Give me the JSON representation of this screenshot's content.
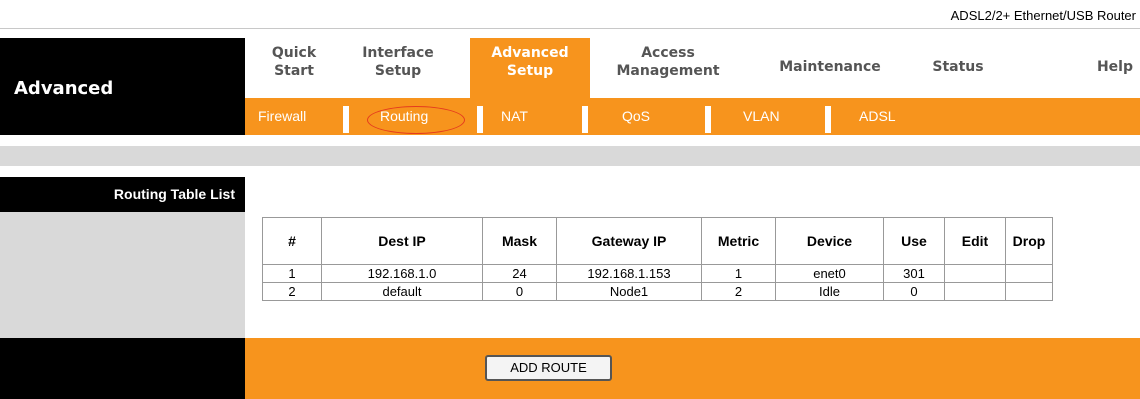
{
  "header": {
    "product_name": "ADSL2/2+ Ethernet/USB Router",
    "brand_label": "Advanced"
  },
  "nav": {
    "items": [
      {
        "label": "Quick\nStart",
        "active": false
      },
      {
        "label": "Interface\nSetup",
        "active": false
      },
      {
        "label": "Advanced\nSetup",
        "active": true
      },
      {
        "label": "Access\nManagement",
        "active": false
      },
      {
        "label": "Maintenance",
        "active": false
      },
      {
        "label": "Status",
        "active": false
      },
      {
        "label": "Help",
        "active": false
      }
    ]
  },
  "subnav": {
    "items": [
      {
        "label": "Firewall"
      },
      {
        "label": "Routing",
        "highlighted": true
      },
      {
        "label": "NAT"
      },
      {
        "label": "QoS"
      },
      {
        "label": "VLAN"
      },
      {
        "label": "ADSL"
      }
    ]
  },
  "section": {
    "title": "Routing Table List"
  },
  "routing_table": {
    "columns": [
      "#",
      "Dest IP",
      "Mask",
      "Gateway IP",
      "Metric",
      "Device",
      "Use",
      "Edit",
      "Drop"
    ],
    "rows": [
      [
        "1",
        "192.168.1.0",
        "24",
        "192.168.1.153",
        "1",
        "enet0",
        "301",
        "",
        ""
      ],
      [
        "2",
        "default",
        "0",
        "Node1",
        "2",
        "Idle",
        "0",
        "",
        ""
      ]
    ]
  },
  "footer": {
    "add_route_label": "ADD ROUTE"
  },
  "colors": {
    "accent": "#f7941d",
    "highlight_ring": "#e53b1e",
    "dark": "#000000",
    "band": "#d9d9d9"
  }
}
